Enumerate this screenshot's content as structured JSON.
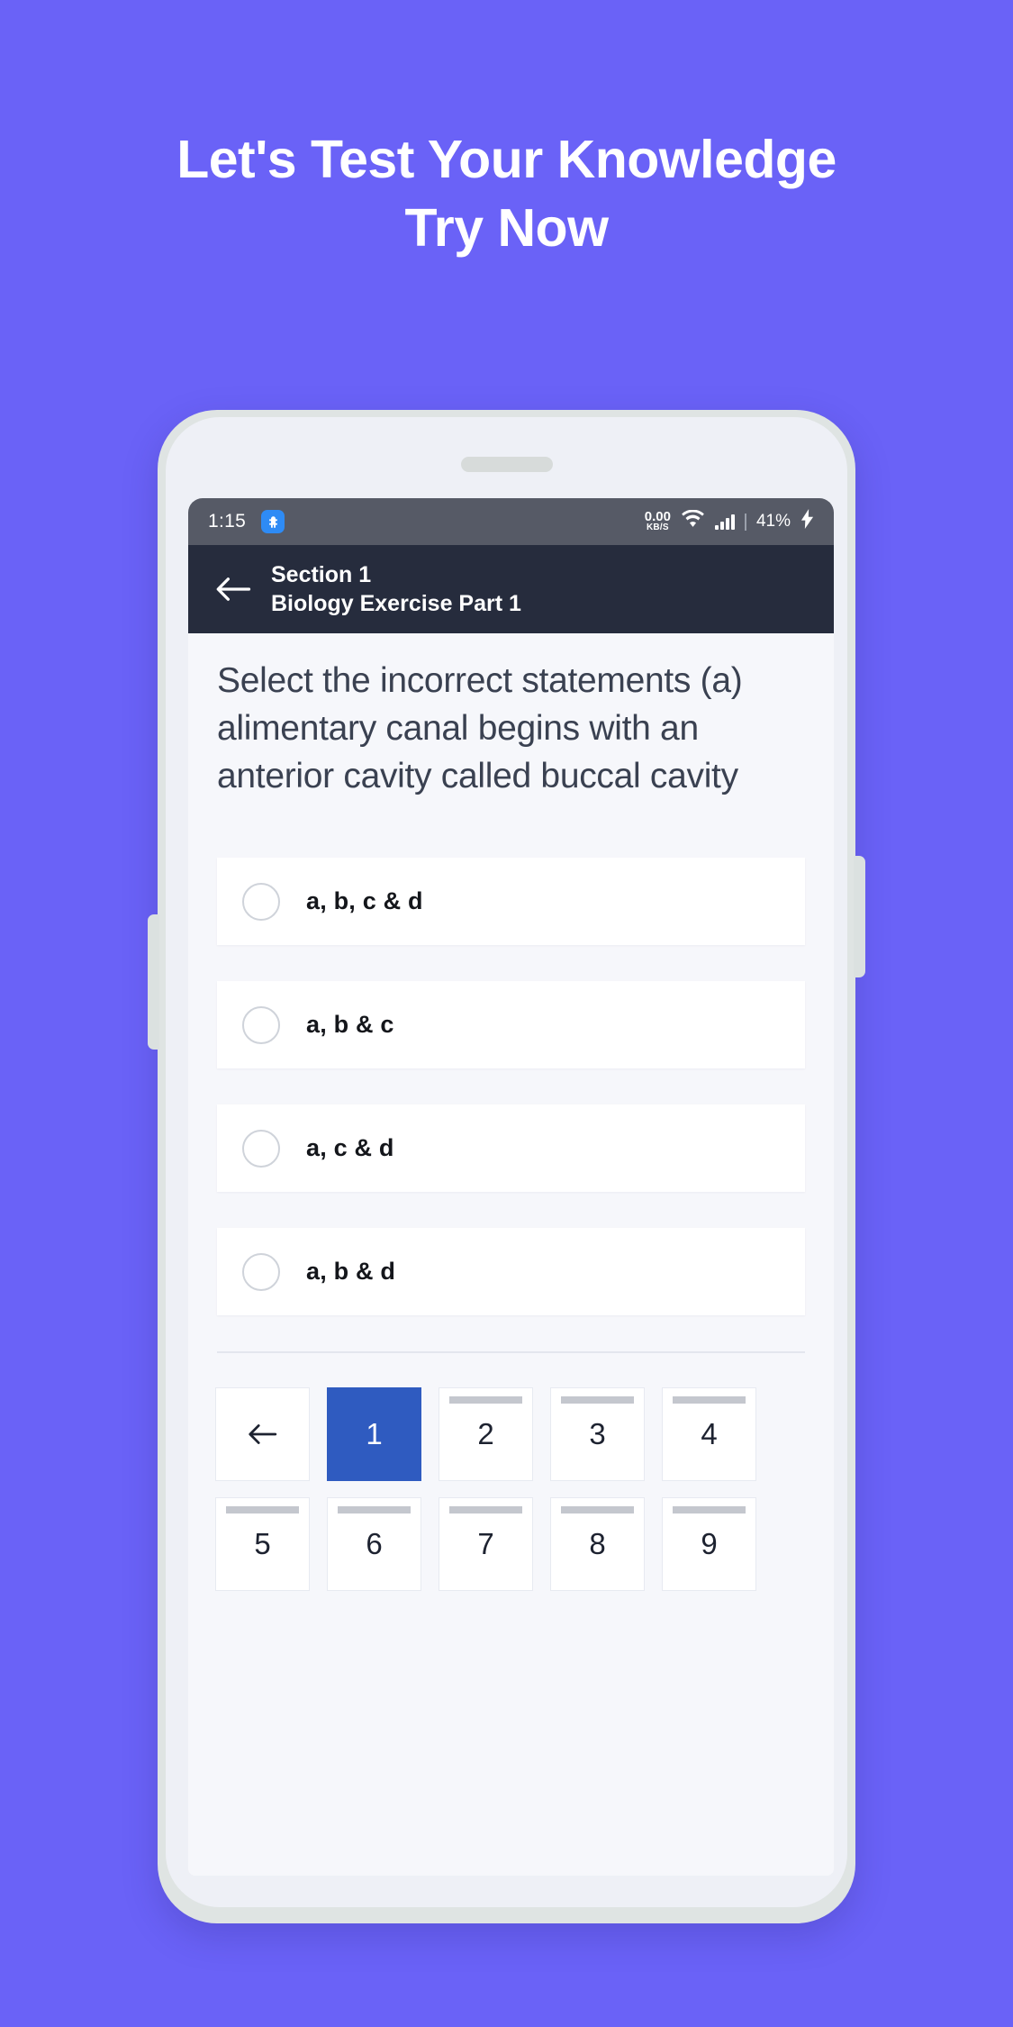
{
  "promo": {
    "line1": "Let's Test Your Knowledge",
    "line2": "Try Now"
  },
  "theme": {
    "background": "#6a62f7",
    "appbar": "#262c3d",
    "statusbar": "#565a66",
    "accent": "#2f5bc0",
    "screen_bg": "#f6f7fb",
    "card": "#ffffff"
  },
  "statusbar": {
    "time": "1:15",
    "badge_icon": "app-notification-icon",
    "net_speed_value": "0.00",
    "net_speed_unit": "KB/S",
    "wifi_icon": "wifi-icon",
    "signal_icon": "cellular-signal-icon",
    "battery": "41%",
    "charging_icon": "charging-bolt-icon"
  },
  "appbar": {
    "back_icon": "back-arrow-icon",
    "title": "Section 1",
    "subtitle": "Biology Exercise Part 1"
  },
  "quiz": {
    "question": "Select the incorrect statements (a) alimentary canal begins with an anterior cavity called buccal cavity",
    "options": [
      {
        "label": "a, b, c & d",
        "selected": false
      },
      {
        "label": "a, b & c",
        "selected": false
      },
      {
        "label": "a, c & d",
        "selected": false
      },
      {
        "label": "a, b & d",
        "selected": false
      }
    ]
  },
  "pagination": {
    "prev_icon": "back-arrow-icon",
    "pages": [
      "1",
      "2",
      "3",
      "4",
      "5",
      "6",
      "7",
      "8",
      "9"
    ],
    "active_page": "1"
  }
}
